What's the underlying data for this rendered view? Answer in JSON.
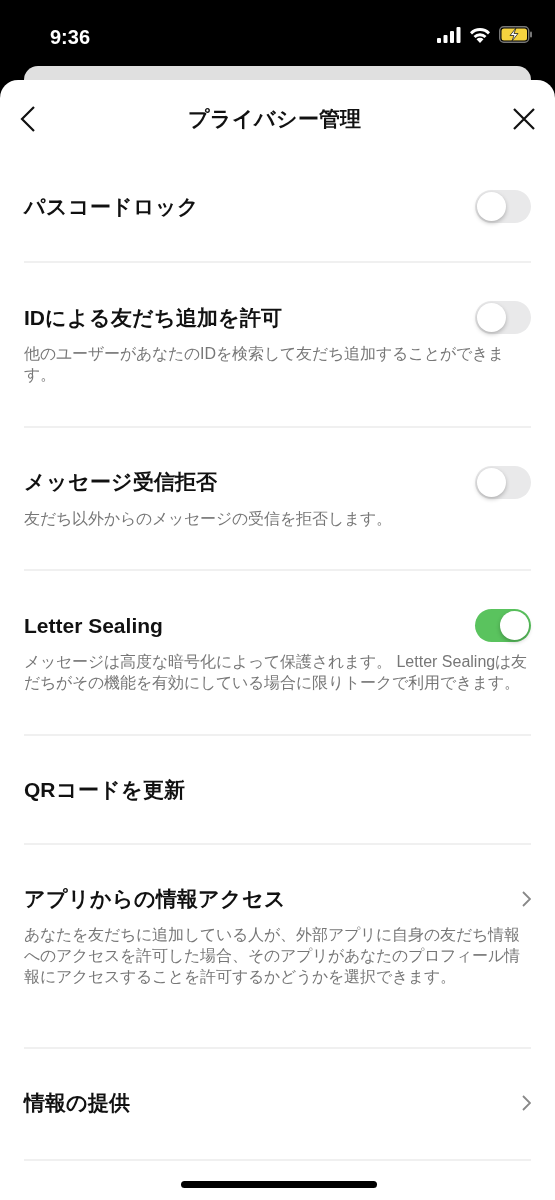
{
  "status_bar": {
    "time": "9:36"
  },
  "header": {
    "title": "プライバシー管理"
  },
  "settings": [
    {
      "kind": "toggle",
      "title": "パスコードロック",
      "on": false
    },
    {
      "kind": "toggle",
      "title": "IDによる友だち追加を許可",
      "description": "他のユーザーがあなたのIDを検索して友だち追加することができます。",
      "on": false
    },
    {
      "kind": "toggle",
      "title": "メッセージ受信拒否",
      "description": "友だち以外からのメッセージの受信を拒否します。",
      "on": false
    },
    {
      "kind": "toggle",
      "title": "Letter Sealing",
      "description": "メッセージは高度な暗号化によって保護されます。 Letter Sealingは友だちがその機能を有効にしている場合に限りトークで利用できます。",
      "on": true
    },
    {
      "kind": "action",
      "title": "QRコードを更新"
    },
    {
      "kind": "link",
      "title": "アプリからの情報アクセス",
      "description": "あなたを友だちに追加している人が、外部アプリに自身の友だち情報へのアクセスを許可した場合、そのアプリがあなたのプロフィール情報にアクセスすることを許可するかどうかを選択できます。"
    },
    {
      "kind": "link",
      "title": "情報の提供"
    }
  ]
}
